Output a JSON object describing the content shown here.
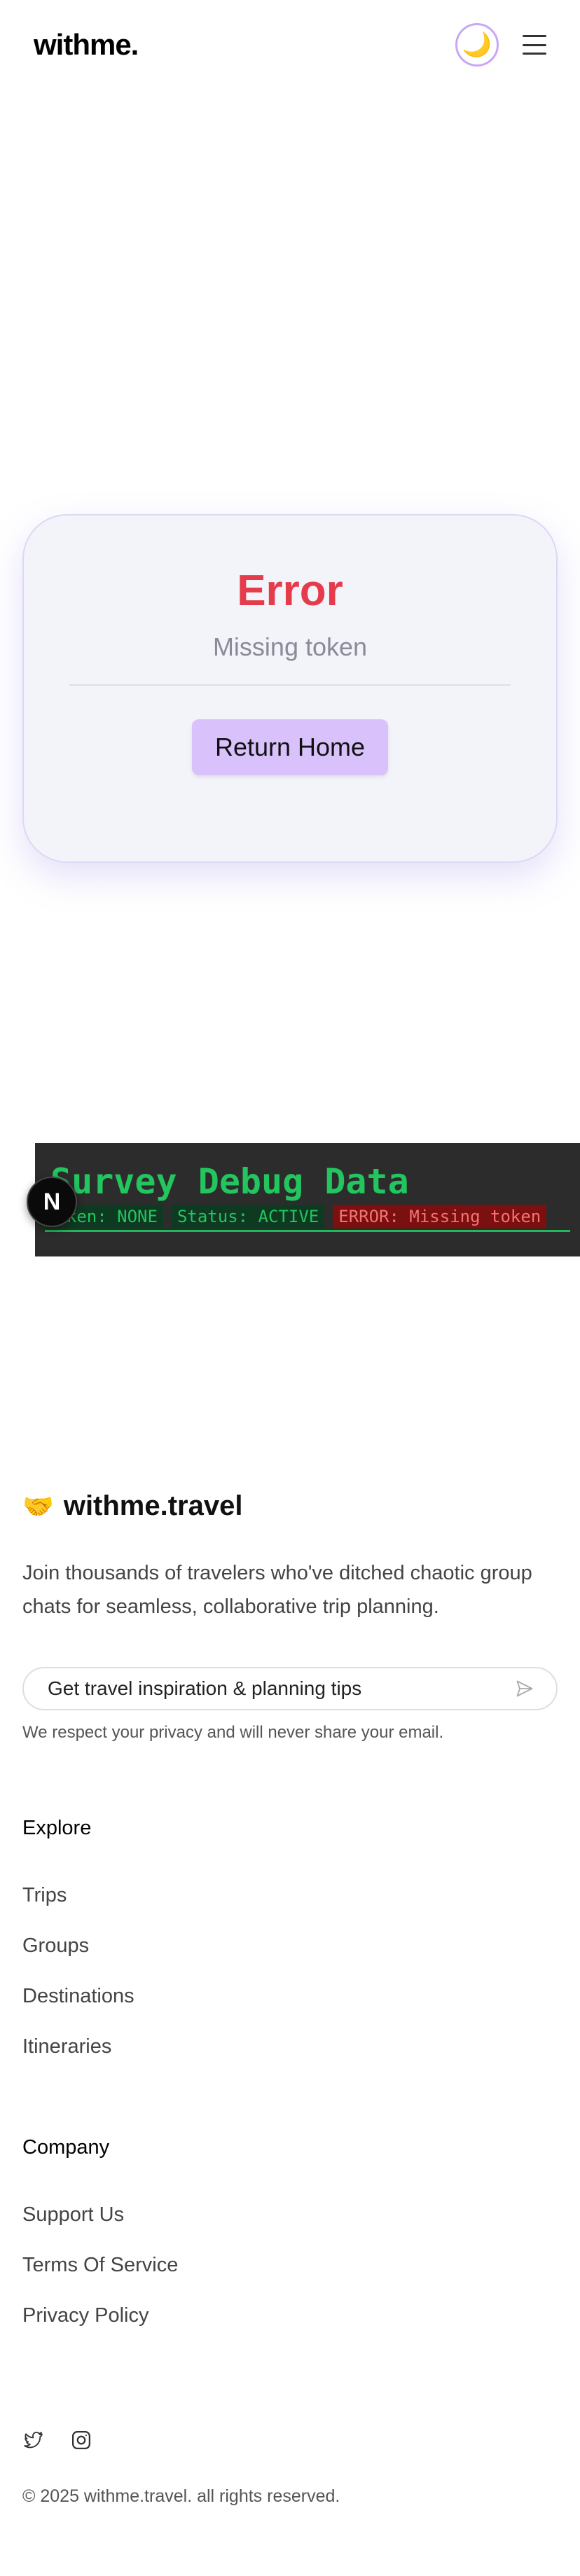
{
  "header": {
    "logo": "withme.",
    "theme_icon": "moon-icon",
    "theme_glyph": "🌙",
    "menu_icon": "hamburger-icon"
  },
  "error_card": {
    "title": "Error",
    "message": "Missing token",
    "button_label": "Return Home"
  },
  "debug": {
    "title": "Survey Debug Data",
    "pills": [
      "Token: NONE",
      "Status: ACTIVE",
      "ERROR: Missing token"
    ],
    "badge": "N"
  },
  "footer": {
    "brand_emoji": "🤝",
    "brand_name": "withme.travel",
    "tagline": "Join thousands of travelers who've ditched chaotic group chats for seamless, collaborative trip planning.",
    "newsletter_placeholder": "Get travel inspiration & planning tips",
    "privacy_note": "We respect your privacy and will never share your email.",
    "explore": {
      "title": "Explore",
      "links": [
        "Trips",
        "Groups",
        "Destinations",
        "Itineraries"
      ]
    },
    "company": {
      "title": "Company",
      "links": [
        "Support Us",
        "Terms Of Service",
        "Privacy Policy"
      ]
    },
    "social_icons": [
      "twitter-icon",
      "instagram-icon"
    ],
    "copyright": "© 2025 withme.travel. all rights reserved."
  },
  "colors": {
    "error": "#e53c4c",
    "button": "#d9c2fc",
    "debug_green": "#22c55e",
    "debug_bg": "#2c2c2c",
    "accent_border": "#c9a7f5"
  }
}
